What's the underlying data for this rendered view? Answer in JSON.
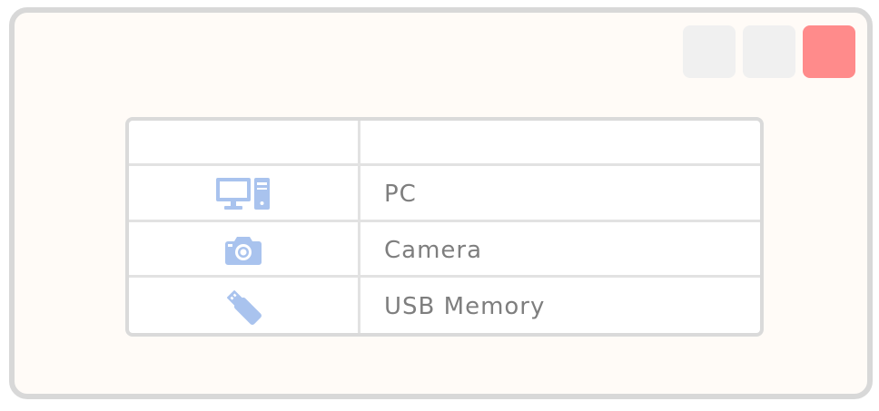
{
  "window": {
    "controls": [
      {
        "name": "minimize-button",
        "color": "#f0f0f0"
      },
      {
        "name": "maximize-button",
        "color": "#f0f0f0"
      },
      {
        "name": "close-button",
        "color": "#ff8b8b"
      }
    ]
  },
  "table": {
    "headers": [
      "",
      ""
    ],
    "rows": [
      {
        "icon": "desktop-pc-icon",
        "label": "PC"
      },
      {
        "icon": "camera-icon",
        "label": "Camera"
      },
      {
        "icon": "usb-memory-icon",
        "label": "USB Memory"
      }
    ]
  },
  "colors": {
    "icon": "#a9c3ee",
    "text": "#7e7e7e",
    "border": "#d8d8d8",
    "close": "#ff8b8b",
    "background": "#fffbf7"
  }
}
